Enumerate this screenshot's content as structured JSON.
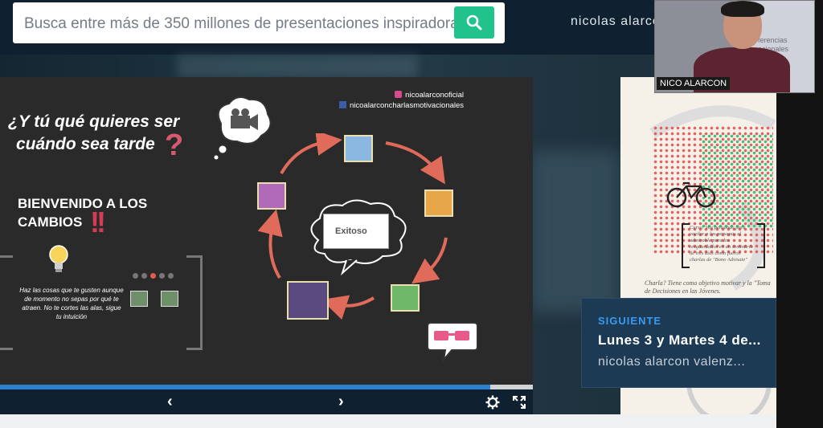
{
  "header": {
    "search_placeholder": "Busca entre más de 350 millones de presentaciones inspiradoras",
    "username": "nicolas alarco"
  },
  "webcam": {
    "name": "NICO ALARCON",
    "poster_text": "ferencias\nacionales\n\nICO N"
  },
  "slide": {
    "social_instagram": "nicoalarconoficial",
    "social_facebook": "nicoalarconcharlasmotivacionales",
    "question_line1": "¿Y tú qué quieres ser",
    "question_line2": "cuándo sea tarde",
    "question_mark": "?",
    "welcome_line1": "BIENVENIDO A LOS",
    "welcome_line2": "CAMBIOS",
    "exclamation": "!!",
    "advice": "Haz las cosas que te gusten aunque de momento no sepas por qué te atraen. No te cortes las alas, sigue tu intuición",
    "center_word": "Exitoso",
    "progress_fraction": 0.92
  },
  "controls": {
    "prev": "‹",
    "next": "›"
  },
  "next_up": {
    "label": "SIGUIENTE",
    "title": "Lunes 3 y Martes 4 de...",
    "author": "nicolas alarcon valenz..."
  },
  "right_panel": {
    "quote": "Curso: Voy pensando para vacilar a las personas el admirable para los resguardados en un seminario de tres días como fueron charlas de \"Bono Advisate\"",
    "charla": "Charla? Tiene como objetivo motivar y la \"Toma de Decisiones en las Jóvenes."
  }
}
